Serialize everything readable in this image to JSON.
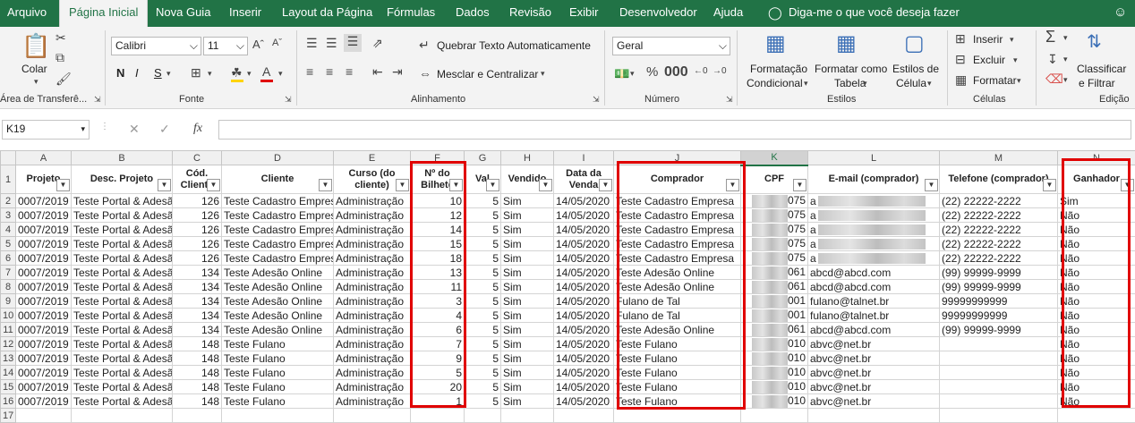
{
  "tabs": [
    "Arquivo",
    "Página Inicial",
    "Nova Guia",
    "Inserir",
    "Layout da Página",
    "Fórmulas",
    "Dados",
    "Revisão",
    "Exibir",
    "Desenvolvedor",
    "Ajuda"
  ],
  "tell_me": "Diga-me o que você deseja fazer",
  "ribbon": {
    "clipboard": {
      "paste": "Colar",
      "label": "Área de Transferê..."
    },
    "font": {
      "name": "Calibri",
      "size": "11",
      "bold": "N",
      "italic": "I",
      "underline": "S",
      "label": "Fonte"
    },
    "alignment": {
      "wrap": "Quebrar Texto Automaticamente",
      "merge": "Mesclar e Centralizar",
      "label": "Alinhamento"
    },
    "number": {
      "format": "Geral",
      "label": "Número"
    },
    "styles": {
      "cond1": "Formatação",
      "cond2": "Condicional",
      "table1": "Formatar como",
      "table2": "Tabela",
      "cell1": "Estilos de",
      "cell2": "Célula",
      "label": "Estilos"
    },
    "cells": {
      "insert": "Inserir",
      "delete": "Excluir",
      "format": "Formatar",
      "label": "Células"
    },
    "editing": {
      "sort1": "Classificar",
      "sort2": "e Filtrar",
      "label": "Edição"
    }
  },
  "formula_bar": {
    "name_box": "K19",
    "fx": "fx",
    "value": ""
  },
  "columns": [
    "A",
    "B",
    "C",
    "D",
    "E",
    "F",
    "G",
    "H",
    "I",
    "J",
    "K",
    "L",
    "M",
    "N"
  ],
  "headers": [
    "Projeto",
    "Desc. Projeto",
    "Cód. Cliente",
    "Cliente",
    "Curso (do cliente)",
    "Nº do Bilhete",
    "Val",
    "Vendido",
    "Data da Venda",
    "Comprador",
    "CPF",
    "E-mail (comprador)",
    "Telefone (comprador)",
    "Ganhador"
  ],
  "rows": [
    [
      "0007/2019",
      "Teste Portal & Adesã",
      "126",
      "Teste Cadastro Empres",
      "Administração",
      "10",
      "5",
      "Sim",
      "14/05/2020",
      "Teste Cadastro Empresa",
      "075",
      "a",
      "(22) 22222-2222",
      "Sim"
    ],
    [
      "0007/2019",
      "Teste Portal & Adesã",
      "126",
      "Teste Cadastro Empres",
      "Administração",
      "12",
      "5",
      "Sim",
      "14/05/2020",
      "Teste Cadastro Empresa",
      "075",
      "a",
      "(22) 22222-2222",
      "Não"
    ],
    [
      "0007/2019",
      "Teste Portal & Adesã",
      "126",
      "Teste Cadastro Empres",
      "Administração",
      "14",
      "5",
      "Sim",
      "14/05/2020",
      "Teste Cadastro Empresa",
      "075",
      "a",
      "(22) 22222-2222",
      "Não"
    ],
    [
      "0007/2019",
      "Teste Portal & Adesã",
      "126",
      "Teste Cadastro Empres",
      "Administração",
      "15",
      "5",
      "Sim",
      "14/05/2020",
      "Teste Cadastro Empresa",
      "075",
      "a",
      "(22) 22222-2222",
      "Não"
    ],
    [
      "0007/2019",
      "Teste Portal & Adesã",
      "126",
      "Teste Cadastro Empres",
      "Administração",
      "18",
      "5",
      "Sim",
      "14/05/2020",
      "Teste Cadastro Empresa",
      "075",
      "a",
      "(22) 22222-2222",
      "Não"
    ],
    [
      "0007/2019",
      "Teste Portal & Adesã",
      "134",
      "Teste Adesão Online",
      "Administração",
      "13",
      "5",
      "Sim",
      "14/05/2020",
      "Teste Adesão Online",
      "061",
      "abcd@abcd.com",
      "(99) 99999-9999",
      "Não"
    ],
    [
      "0007/2019",
      "Teste Portal & Adesã",
      "134",
      "Teste Adesão Online",
      "Administração",
      "11",
      "5",
      "Sim",
      "14/05/2020",
      "Teste Adesão Online",
      "061",
      "abcd@abcd.com",
      "(99) 99999-9999",
      "Não"
    ],
    [
      "0007/2019",
      "Teste Portal & Adesã",
      "134",
      "Teste Adesão Online",
      "Administração",
      "3",
      "5",
      "Sim",
      "14/05/2020",
      "Fulano de Tal",
      "001",
      "fulano@talnet.br",
      "99999999999",
      "Não"
    ],
    [
      "0007/2019",
      "Teste Portal & Adesã",
      "134",
      "Teste Adesão Online",
      "Administração",
      "4",
      "5",
      "Sim",
      "14/05/2020",
      "Fulano de Tal",
      "001",
      "fulano@talnet.br",
      "99999999999",
      "Não"
    ],
    [
      "0007/2019",
      "Teste Portal & Adesã",
      "134",
      "Teste Adesão Online",
      "Administração",
      "6",
      "5",
      "Sim",
      "14/05/2020",
      "Teste Adesão Online",
      "061",
      "abcd@abcd.com",
      "(99) 99999-9999",
      "Não"
    ],
    [
      "0007/2019",
      "Teste Portal & Adesã",
      "148",
      "Teste Fulano",
      "Administração",
      "7",
      "5",
      "Sim",
      "14/05/2020",
      "Teste Fulano",
      "010",
      "abvc@net.br",
      "",
      "Não"
    ],
    [
      "0007/2019",
      "Teste Portal & Adesã",
      "148",
      "Teste Fulano",
      "Administração",
      "9",
      "5",
      "Sim",
      "14/05/2020",
      "Teste Fulano",
      "010",
      "abvc@net.br",
      "",
      "Não"
    ],
    [
      "0007/2019",
      "Teste Portal & Adesã",
      "148",
      "Teste Fulano",
      "Administração",
      "5",
      "5",
      "Sim",
      "14/05/2020",
      "Teste Fulano",
      "010",
      "abvc@net.br",
      "",
      "Não"
    ],
    [
      "0007/2019",
      "Teste Portal & Adesã",
      "148",
      "Teste Fulano",
      "Administração",
      "20",
      "5",
      "Sim",
      "14/05/2020",
      "Teste Fulano",
      "010",
      "abvc@net.br",
      "",
      "Não"
    ],
    [
      "0007/2019",
      "Teste Portal & Adesã",
      "148",
      "Teste Fulano",
      "Administração",
      "1",
      "5",
      "Sim",
      "14/05/2020",
      "Teste Fulano",
      "010",
      "abvc@net.br",
      "",
      "Não"
    ]
  ],
  "colors": {
    "accent": "#217346",
    "highlight": "#e00000"
  }
}
